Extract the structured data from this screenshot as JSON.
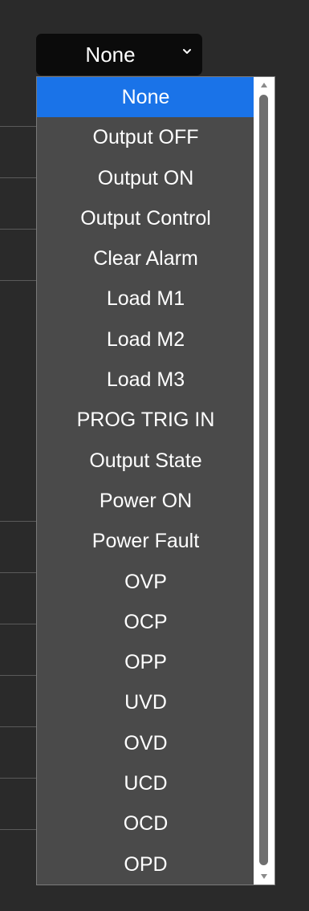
{
  "select": {
    "value": "None",
    "chevron_icon": "chevron-down-icon"
  },
  "dropdown": {
    "options": [
      "None",
      "Output OFF",
      "Output ON",
      "Output Control",
      "Clear Alarm",
      "Load M1",
      "Load M2",
      "Load M3",
      "PROG TRIG IN",
      "Output State",
      "Power ON",
      "Power Fault",
      "OVP",
      "OCP",
      "OPP",
      "UVD",
      "OVD",
      "UCD",
      "OCD",
      "OPD"
    ],
    "selected_index": 0,
    "scroll_position": 0
  },
  "colors": {
    "background": "#2a2a2a",
    "select_bg": "#0b0b0b",
    "list_bg": "#4a4a4a",
    "selected_bg": "#1a73e8",
    "scroll_thumb": "#6f6f6f"
  }
}
